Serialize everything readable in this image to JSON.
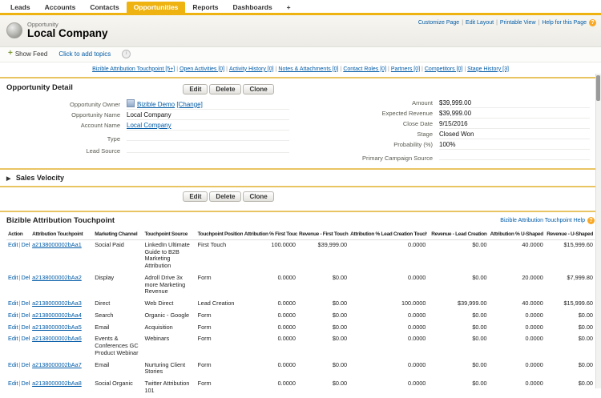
{
  "separator": "|",
  "colors": {
    "accent_gold": "#eeb211",
    "section_border": "#e9c463",
    "link_blue": "#015ba7",
    "help_orange": "#f9a825"
  },
  "nav": {
    "tabs": [
      {
        "label": "Leads",
        "active": false
      },
      {
        "label": "Accounts",
        "active": false
      },
      {
        "label": "Contacts",
        "active": false
      },
      {
        "label": "Opportunities",
        "active": true
      },
      {
        "label": "Reports",
        "active": false
      },
      {
        "label": "Dashboards",
        "active": false
      },
      {
        "label": "+",
        "active": false
      }
    ]
  },
  "header": {
    "record_type": "Opportunity",
    "title": "Local Company",
    "links": [
      "Customize Page",
      "Edit Layout",
      "Printable View",
      "Help for this Page"
    ],
    "help_glyph": "?"
  },
  "feed": {
    "show_feed_label": "Show Feed",
    "plus_glyph": "+",
    "add_topics_label": "Click to add topics",
    "info_glyph": "i"
  },
  "related_links": [
    {
      "label": "Bizible Attribution Touchpoint",
      "count": "[5+]"
    },
    {
      "label": "Open Activities",
      "count": "[0]"
    },
    {
      "label": "Activity History",
      "count": "[0]"
    },
    {
      "label": "Notes & Attachments",
      "count": "[0]"
    },
    {
      "label": "Contact Roles",
      "count": "[0]"
    },
    {
      "label": "Partners",
      "count": "[0]"
    },
    {
      "label": "Competitors",
      "count": "[0]"
    },
    {
      "label": "Stage History",
      "count": "[3]"
    }
  ],
  "detail": {
    "title": "Opportunity Detail",
    "buttons": [
      "Edit",
      "Delete",
      "Clone"
    ],
    "left_fields": [
      {
        "label": "Opportunity Owner",
        "value": "Bizible Demo",
        "extra": "[Change]",
        "link": true,
        "icon": true
      },
      {
        "label": "Opportunity Name",
        "value": "Local Company",
        "link": false
      },
      {
        "label": "Account Name",
        "value": "Local Company",
        "link": true
      },
      {
        "label": "Type",
        "value": "",
        "link": false
      },
      {
        "label": "Lead Source",
        "value": "",
        "link": false
      }
    ],
    "right_fields": [
      {
        "label": "Amount",
        "value": "$39,999.00",
        "link": false
      },
      {
        "label": "Expected Revenue",
        "value": "$39,999.00",
        "link": false
      },
      {
        "label": "Close Date",
        "value": "9/15/2016",
        "link": false
      },
      {
        "label": "Stage",
        "value": "Closed Won",
        "link": false
      },
      {
        "label": "Probability (%)",
        "value": "100%",
        "link": false
      },
      {
        "label": "Primary Campaign Source",
        "value": "",
        "link": false
      }
    ]
  },
  "sales_velocity": {
    "title": "Sales Velocity",
    "collapsed_glyph": "▶"
  },
  "touchpoint": {
    "title": "Bizible Attribution Touchpoint",
    "help_label": "Bizible Attribution Touchpoint Help",
    "help_glyph": "?",
    "buttons": [
      "Edit",
      "Delete",
      "Clone"
    ],
    "action_links": [
      "Edit",
      "Del"
    ],
    "columns": [
      "Action",
      "Attribution Touchpoint",
      "Marketing Channel",
      "Touchpoint Source",
      "Touchpoint Position",
      "Attribution % First Touch",
      "Revenue - First Touch",
      "Attribution % Lead Creation Touch",
      "Revenue - Lead Creation",
      "Attribution % U-Shaped",
      "Revenue - U-Shaped"
    ],
    "rows": [
      {
        "id": "a2138000002bAa1",
        "channel": "Social Paid",
        "source": "LinkedIn Ultimate Guide to B2B Marketing Attribution",
        "position": "First Touch",
        "attr_first": "100.0000",
        "rev_first": "$39,999.00",
        "attr_lead": "0.0000",
        "rev_lead": "$0.00",
        "attr_u": "40.0000",
        "rev_u": "$15,999.60"
      },
      {
        "id": "a2138000002bAa2",
        "channel": "Display",
        "source": "Adroll Drive 3x more Marketing Revenue",
        "position": "Form",
        "attr_first": "0.0000",
        "rev_first": "$0.00",
        "attr_lead": "0.0000",
        "rev_lead": "$0.00",
        "attr_u": "20.0000",
        "rev_u": "$7,999.80"
      },
      {
        "id": "a2138000002bAa3",
        "channel": "Direct",
        "source": "Web Direct",
        "position": "Lead Creation",
        "attr_first": "0.0000",
        "rev_first": "$0.00",
        "attr_lead": "100.0000",
        "rev_lead": "$39,999.00",
        "attr_u": "40.0000",
        "rev_u": "$15,999.60"
      },
      {
        "id": "a2138000002bAa4",
        "channel": "Search",
        "source": "Organic - Google",
        "position": "Form",
        "attr_first": "0.0000",
        "rev_first": "$0.00",
        "attr_lead": "0.0000",
        "rev_lead": "$0.00",
        "attr_u": "0.0000",
        "rev_u": "$0.00"
      },
      {
        "id": "a2138000002bAa5",
        "channel": "Email",
        "source": "Acquisition",
        "position": "Form",
        "attr_first": "0.0000",
        "rev_first": "$0.00",
        "attr_lead": "0.0000",
        "rev_lead": "$0.00",
        "attr_u": "0.0000",
        "rev_u": "$0.00"
      },
      {
        "id": "a2138000002bAa6",
        "channel": "Events & Conferences GC Product Webinar",
        "source": "Webinars",
        "position": "Form",
        "attr_first": "0.0000",
        "rev_first": "$0.00",
        "attr_lead": "0.0000",
        "rev_lead": "$0.00",
        "attr_u": "0.0000",
        "rev_u": "$0.00"
      },
      {
        "id": "a2138000002bAa7",
        "channel": "Email",
        "source": "Nurturing Client Stories",
        "position": "Form",
        "attr_first": "0.0000",
        "rev_first": "$0.00",
        "attr_lead": "0.0000",
        "rev_lead": "$0.00",
        "attr_u": "0.0000",
        "rev_u": "$0.00"
      },
      {
        "id": "a2138000002bAa8",
        "channel": "Social Organic",
        "source": "Twitter Attribution 101",
        "position": "Form",
        "attr_first": "0.0000",
        "rev_first": "$0.00",
        "attr_lead": "0.0000",
        "rev_lead": "$0.00",
        "attr_u": "0.0000",
        "rev_u": "$0.00"
      }
    ]
  }
}
